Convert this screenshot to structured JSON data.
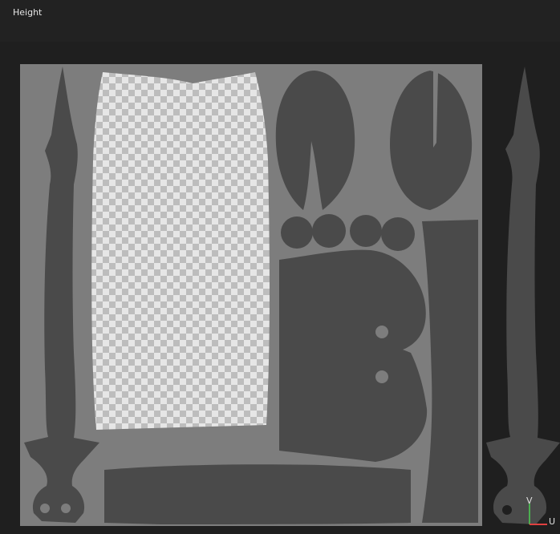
{
  "panel": {
    "title": "Height"
  },
  "axis": {
    "v_label": "V",
    "u_label": "U",
    "v_color": "#4caf50",
    "u_color": "#e04040"
  },
  "colors": {
    "background": "#1f1f1f",
    "uv_tile": "#7d7d7d",
    "uv_shell": "#4a4a4a",
    "checker_light": "#e6e6e6",
    "checker_dark": "#bdbdbd"
  }
}
